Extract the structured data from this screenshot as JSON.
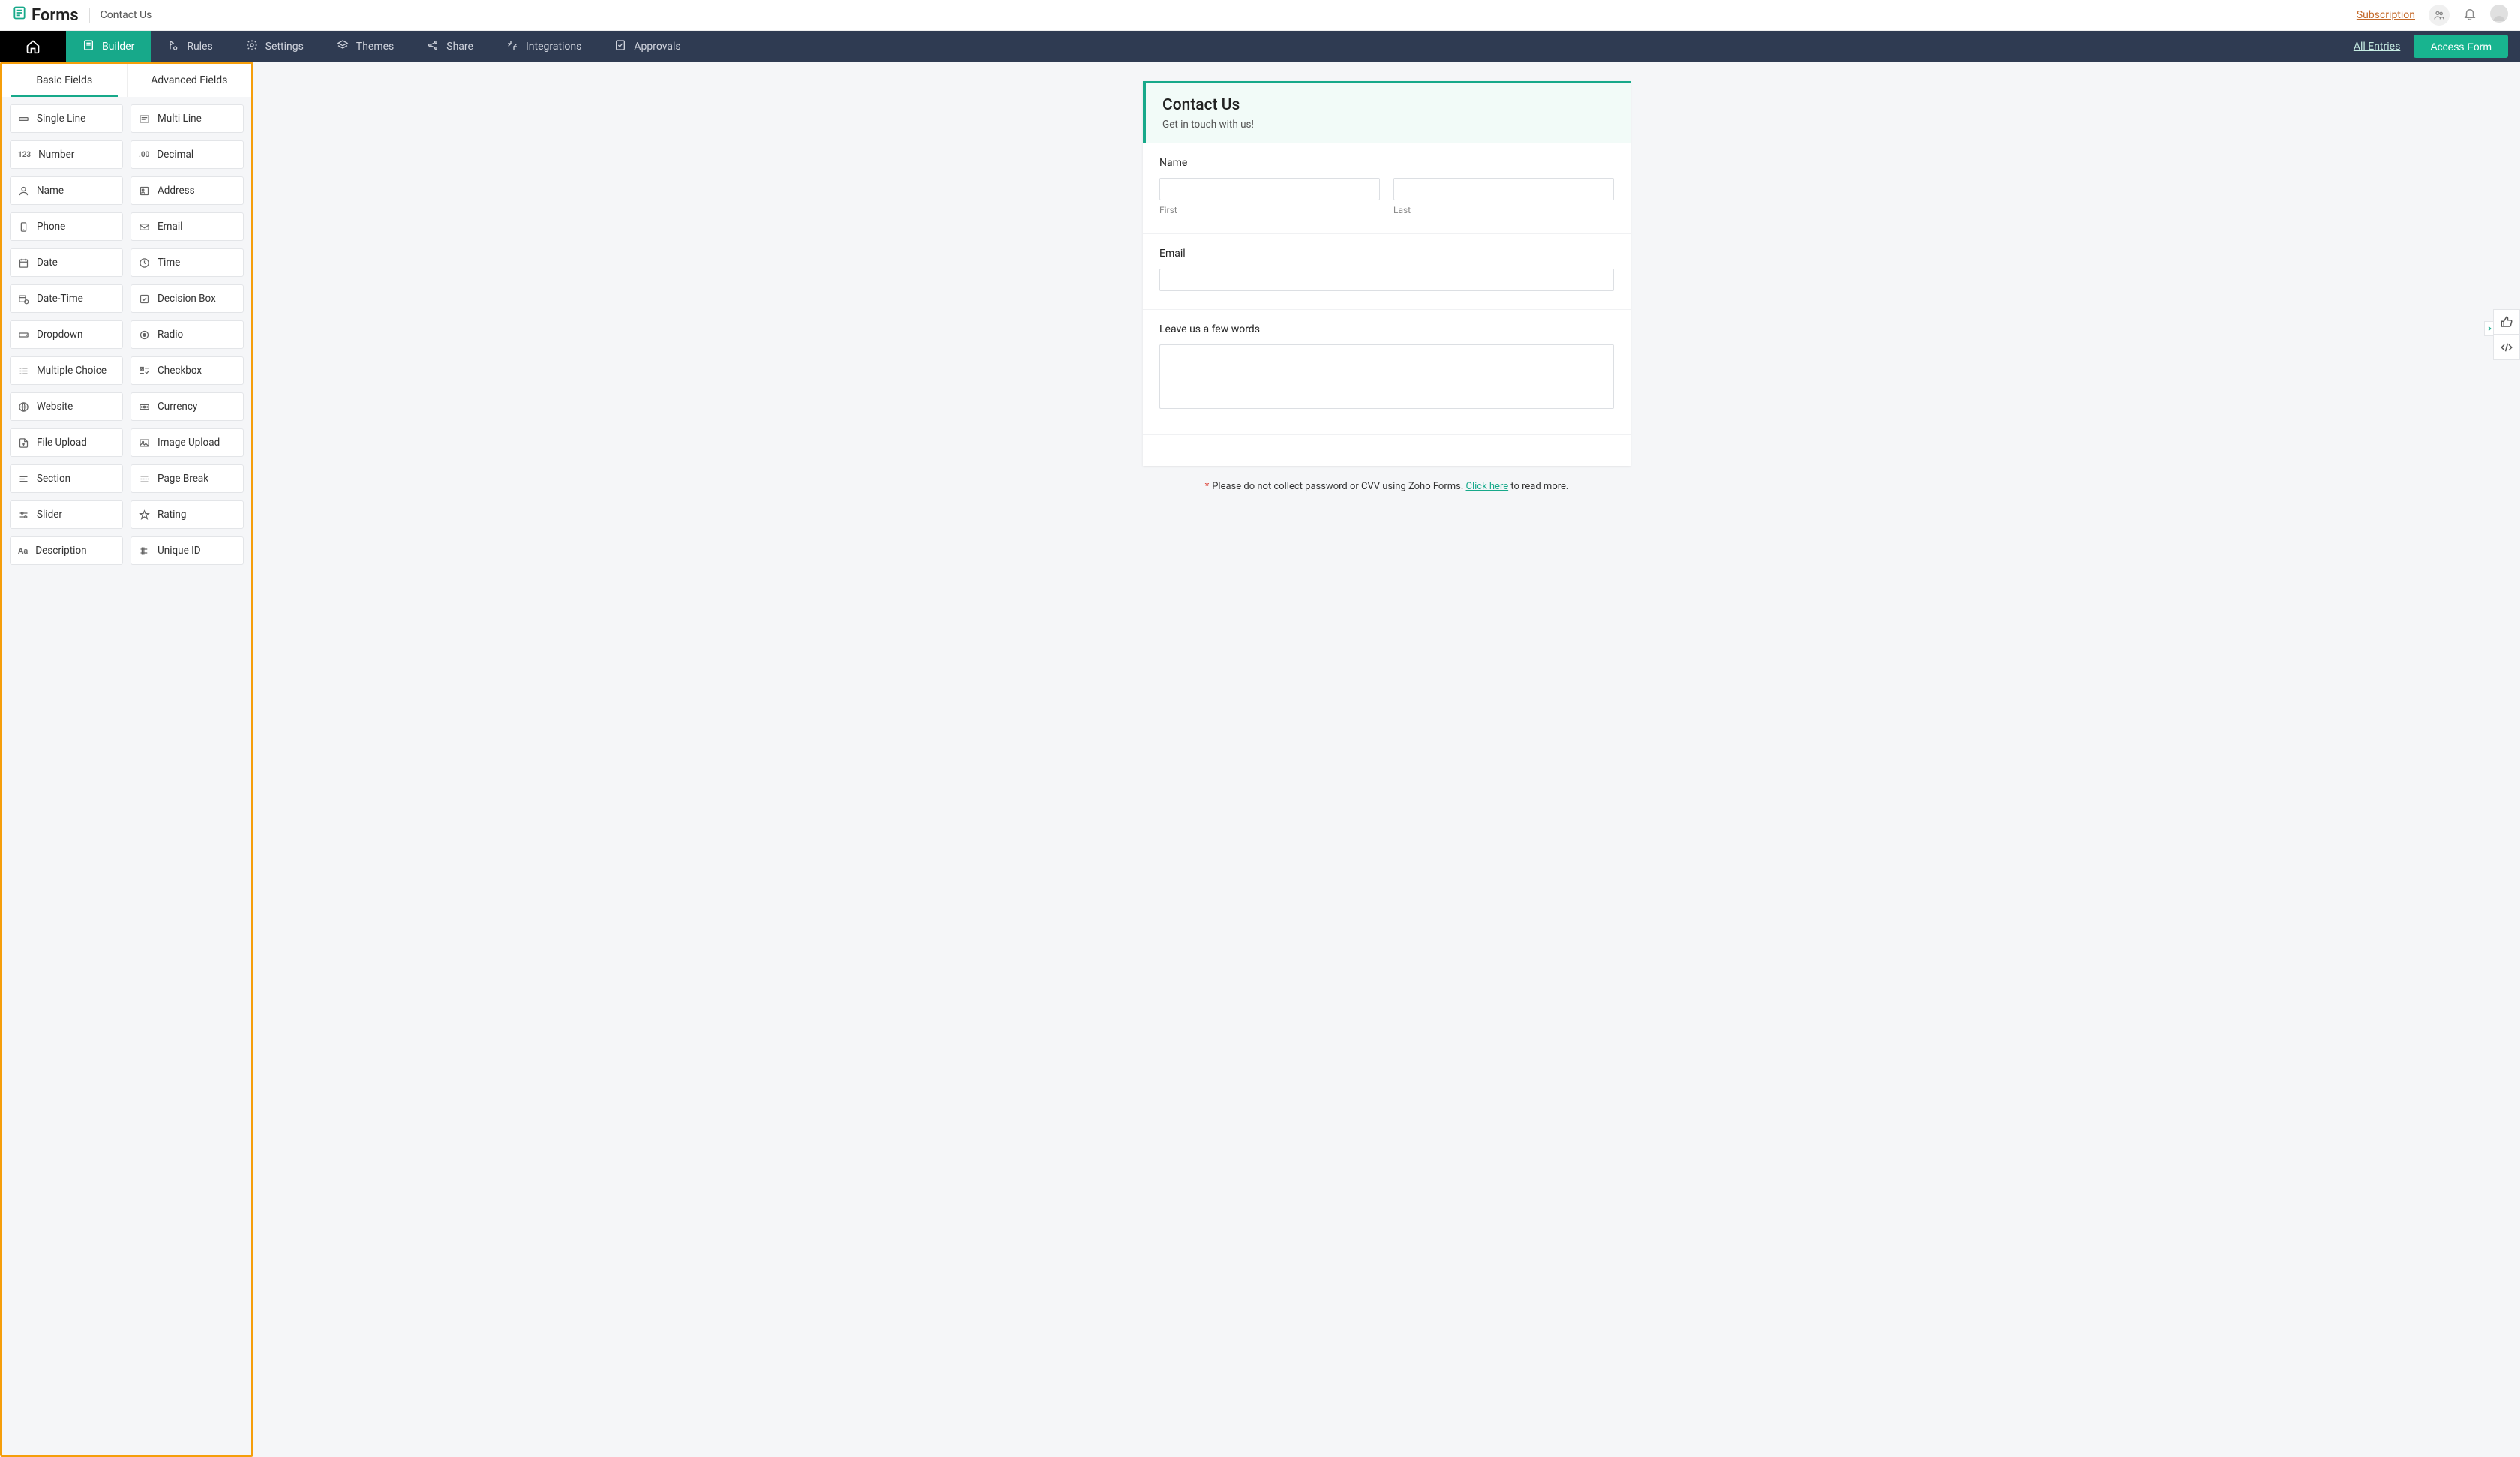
{
  "header": {
    "app_name": "Forms",
    "breadcrumb": "Contact Us",
    "subscription_label": "Subscription"
  },
  "nav": {
    "items": [
      {
        "label": "Builder"
      },
      {
        "label": "Rules"
      },
      {
        "label": "Settings"
      },
      {
        "label": "Themes"
      },
      {
        "label": "Share"
      },
      {
        "label": "Integrations"
      },
      {
        "label": "Approvals"
      }
    ],
    "all_entries_label": "All Entries",
    "access_form_label": "Access Form"
  },
  "sidebar": {
    "tabs": {
      "basic": "Basic Fields",
      "advanced": "Advanced Fields"
    },
    "fields": [
      {
        "label": "Single Line"
      },
      {
        "label": "Multi Line"
      },
      {
        "label": "Number"
      },
      {
        "label": "Decimal"
      },
      {
        "label": "Name"
      },
      {
        "label": "Address"
      },
      {
        "label": "Phone"
      },
      {
        "label": "Email"
      },
      {
        "label": "Date"
      },
      {
        "label": "Time"
      },
      {
        "label": "Date-Time"
      },
      {
        "label": "Decision Box"
      },
      {
        "label": "Dropdown"
      },
      {
        "label": "Radio"
      },
      {
        "label": "Multiple Choice"
      },
      {
        "label": "Checkbox"
      },
      {
        "label": "Website"
      },
      {
        "label": "Currency"
      },
      {
        "label": "File Upload"
      },
      {
        "label": "Image Upload"
      },
      {
        "label": "Section"
      },
      {
        "label": "Page Break"
      },
      {
        "label": "Slider"
      },
      {
        "label": "Rating"
      },
      {
        "label": "Description"
      },
      {
        "label": "Unique ID"
      }
    ]
  },
  "form": {
    "title": "Contact Us",
    "subtitle": "Get in touch with us!",
    "name_label": "Name",
    "first_label": "First",
    "last_label": "Last",
    "email_label": "Email",
    "message_label": "Leave us a few words",
    "footer_note_1": "Please do not collect password or CVV using Zoho Forms. ",
    "footer_link": "Click here",
    "footer_note_2": " to read more."
  }
}
